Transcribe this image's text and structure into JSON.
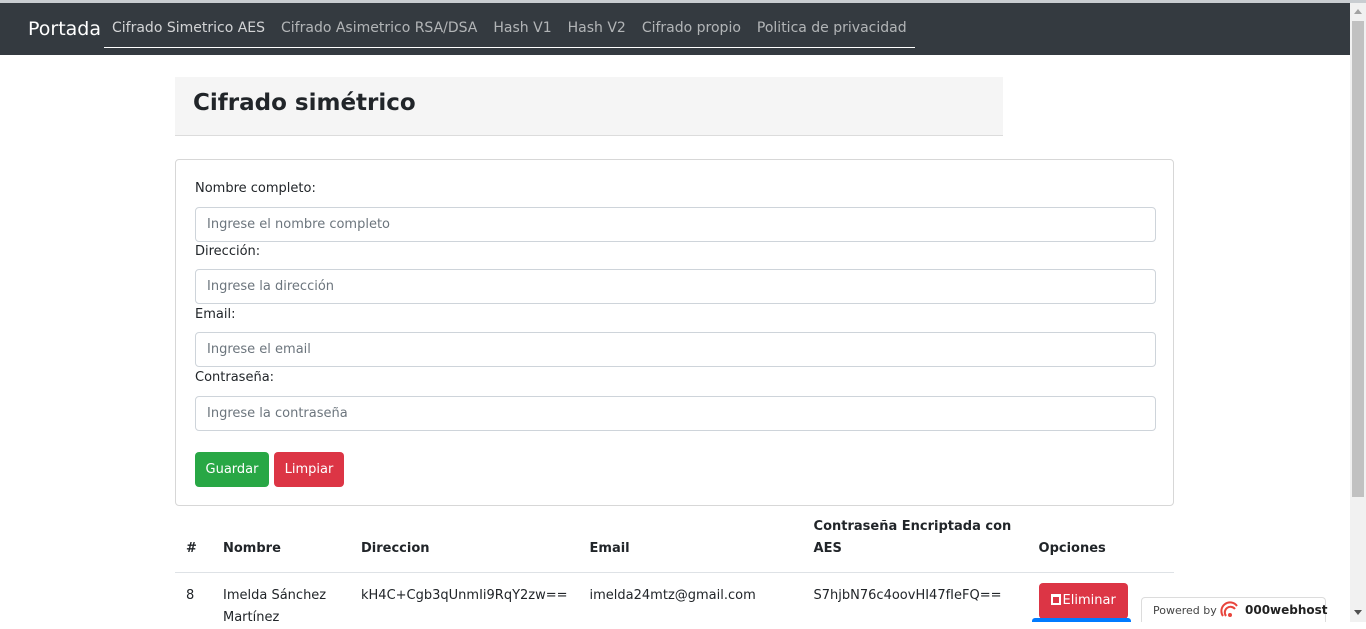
{
  "navbar": {
    "brand": "Portada",
    "links": [
      "Cifrado Simetrico AES",
      "Cifrado Asimetrico RSA/DSA",
      "Hash V1",
      "Hash V2",
      "Cifrado propio",
      "Politica de privacidad"
    ]
  },
  "jumbotron": {
    "title": "Cifrado simétrico"
  },
  "form": {
    "name_label": "Nombre completo:",
    "name_placeholder": "Ingrese el nombre completo",
    "address_label": "Dirección:",
    "address_placeholder": "Ingrese la dirección",
    "email_label": "Email:",
    "email_placeholder": "Ingrese el email",
    "password_label": "Contraseña:",
    "password_placeholder": "Ingrese la contraseña",
    "save_label": "Guardar",
    "clear_label": "Limpiar"
  },
  "table": {
    "headers": [
      "#",
      "Nombre",
      "Direccion",
      "Email",
      "Contraseña Encriptada con AES",
      "Opciones"
    ],
    "rows": [
      {
        "id": "8",
        "name": "Imelda Sánchez Martínez",
        "address": "kH4C+Cgb3qUnmIi9RqY2zw==",
        "email": "imelda24mtz@gmail.com",
        "password": "S7hjbN76c4oovHI47fIeFQ==",
        "delete_label": "Eliminar"
      }
    ]
  },
  "badge": {
    "powered": "Powered by",
    "host": "000webhost"
  },
  "colors": {
    "navbar": "#343a40",
    "save": "#28a745",
    "clear": "#dc3545",
    "delete": "#dc3545",
    "edit": "#007bff"
  }
}
